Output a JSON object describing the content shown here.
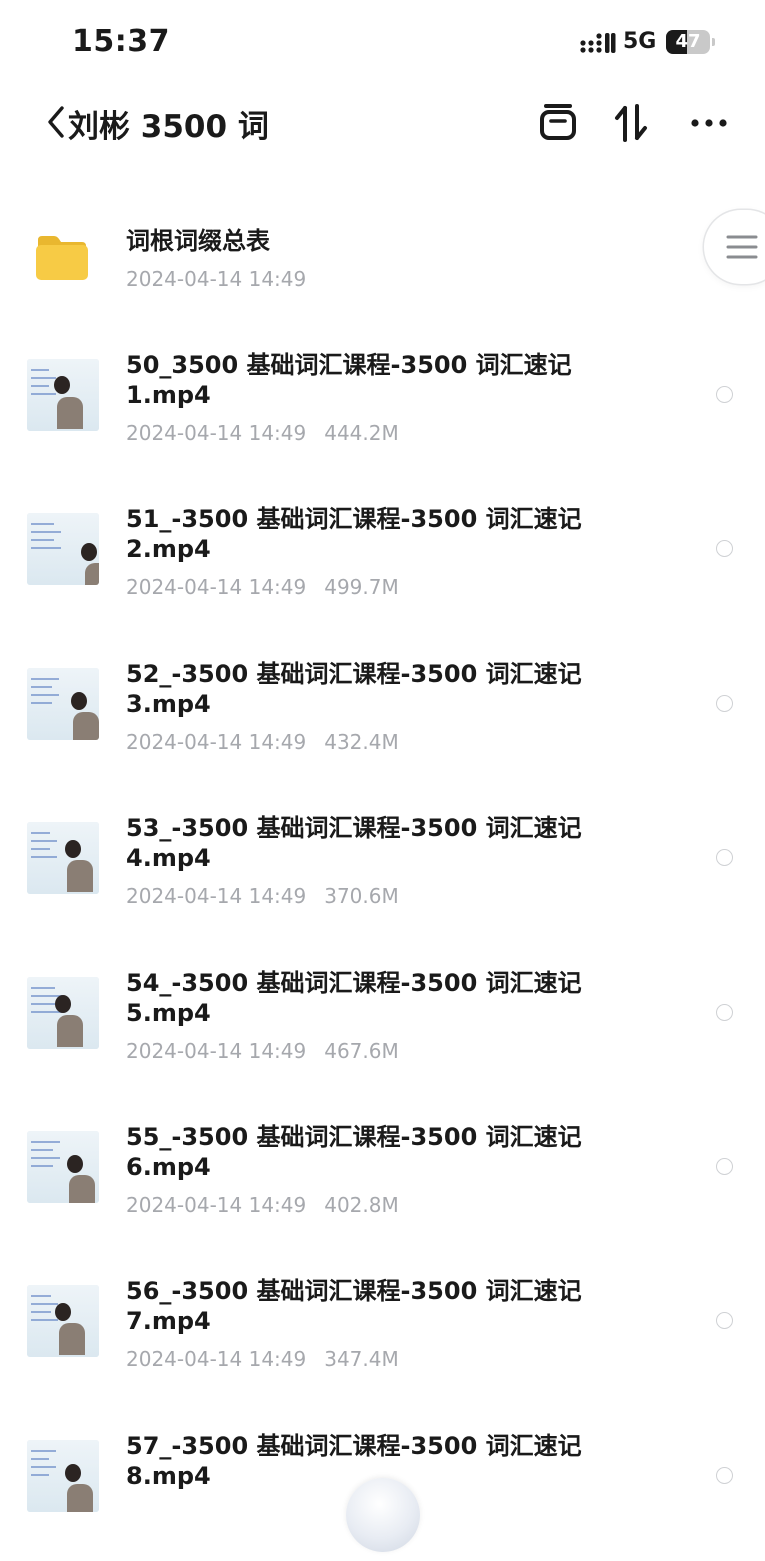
{
  "status_bar": {
    "time": "15:37",
    "network": "5G",
    "battery_percent": "47",
    "battery_level": 0.47
  },
  "nav": {
    "back_icon": "chevron-left-icon",
    "title": "刘彬 3500 词",
    "actions": [
      "archive-icon",
      "sort-icon",
      "more-icon"
    ]
  },
  "folder": {
    "name": "词根词缀总表",
    "date": "2024-04-14 14:49",
    "icon": "folder-icon",
    "icon_color": "#F7CB45"
  },
  "files": [
    {
      "line1": "50_3500 基础词汇课程-3500 词汇速记",
      "line2": "1.mp4",
      "date": "2024-04-14 14:49",
      "size": "444.2M"
    },
    {
      "line1": "51_-3500 基础词汇课程-3500 词汇速记",
      "line2": "2.mp4",
      "date": "2024-04-14 14:49",
      "size": "499.7M"
    },
    {
      "line1": "52_-3500 基础词汇课程-3500 词汇速记",
      "line2": "3.mp4",
      "date": "2024-04-14 14:49",
      "size": "432.4M"
    },
    {
      "line1": "53_-3500 基础词汇课程-3500 词汇速记",
      "line2": "4.mp4",
      "date": "2024-04-14 14:49",
      "size": "370.6M"
    },
    {
      "line1": "54_-3500 基础词汇课程-3500 词汇速记",
      "line2": "5.mp4",
      "date": "2024-04-14 14:49",
      "size": "467.6M"
    },
    {
      "line1": "55_-3500 基础词汇课程-3500 词汇速记",
      "line2": "6.mp4",
      "date": "2024-04-14 14:49",
      "size": "402.8M"
    },
    {
      "line1": "56_-3500 基础词汇课程-3500 词汇速记",
      "line2": "7.mp4",
      "date": "2024-04-14 14:49",
      "size": "347.4M"
    },
    {
      "line1": "57_-3500 基础词汇课程-3500 词汇速记",
      "line2": "8.mp4",
      "date": "",
      "size": ""
    }
  ],
  "side_handle": {
    "icon": "menu-icon"
  },
  "floating_button": {
    "icon": "assistant-orb-icon"
  },
  "colors": {
    "text_primary": "#1A1A1A",
    "text_secondary": "#A6A8AD",
    "radio_border": "#CFD1D4"
  }
}
